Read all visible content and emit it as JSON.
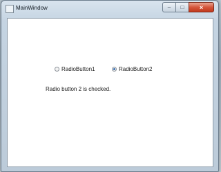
{
  "window": {
    "title": "MainWindow",
    "caption_buttons": {
      "minimize": "–",
      "maximize": "□",
      "close": "×"
    }
  },
  "radios": [
    {
      "label": "RadioButton1",
      "checked": false
    },
    {
      "label": "RadioButton2",
      "checked": true
    }
  ],
  "status": {
    "text": "Radio button 2 is checked."
  },
  "colors": {
    "close_button": "#d5563c",
    "radio_dot": "#3a6fb0"
  }
}
